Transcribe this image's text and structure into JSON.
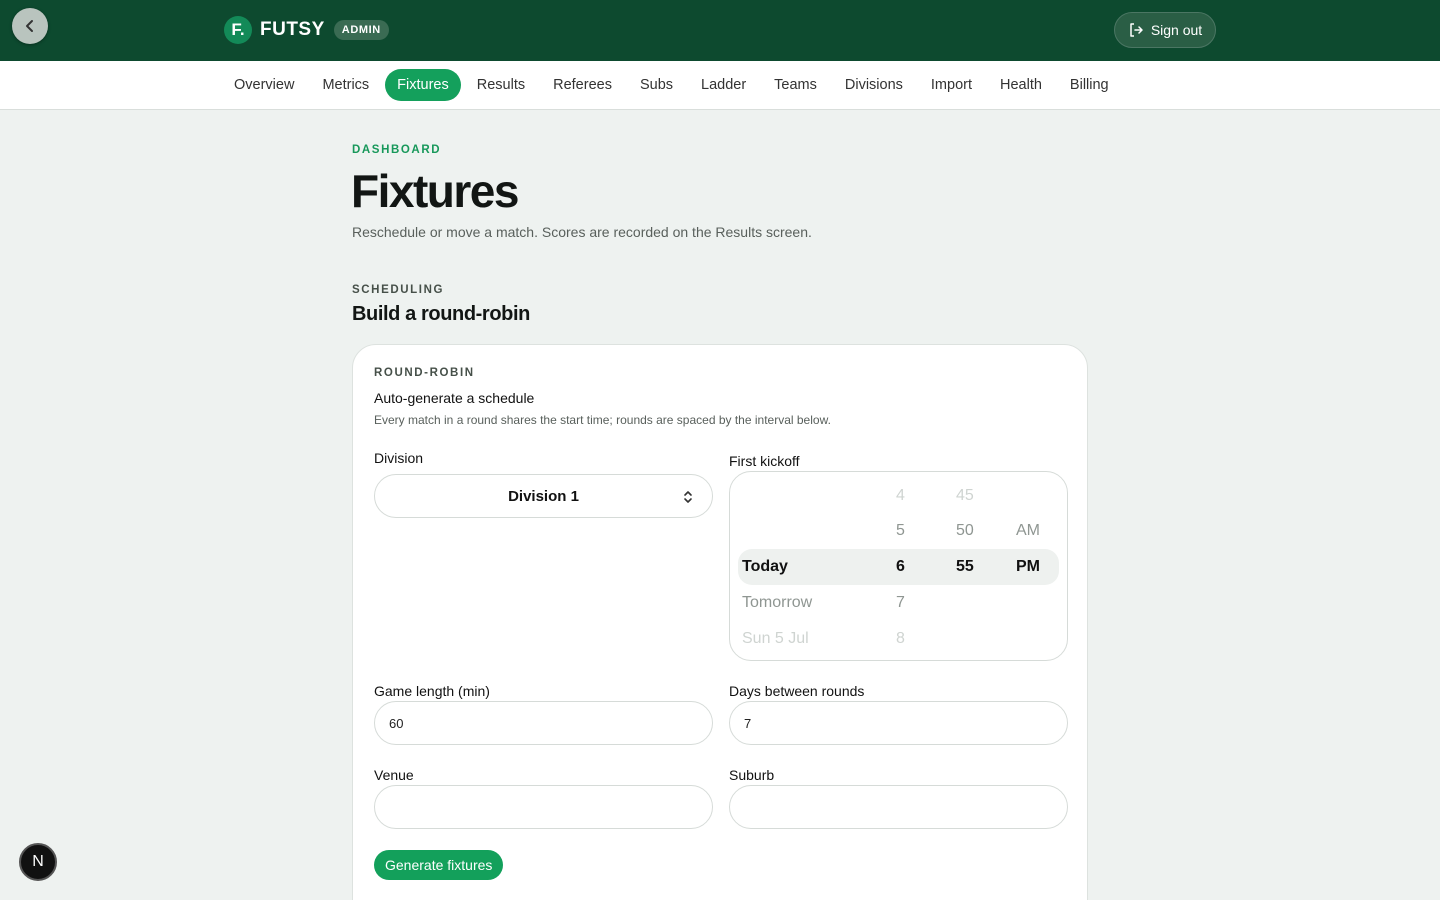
{
  "brand": {
    "logo": "F.",
    "name": "FUTSY",
    "badge": "ADMIN"
  },
  "header": {
    "signout_label": "Sign out"
  },
  "nav": {
    "items": [
      {
        "label": "Overview"
      },
      {
        "label": "Metrics"
      },
      {
        "label": "Fixtures"
      },
      {
        "label": "Results"
      },
      {
        "label": "Referees"
      },
      {
        "label": "Subs"
      },
      {
        "label": "Ladder"
      },
      {
        "label": "Teams"
      },
      {
        "label": "Divisions"
      },
      {
        "label": "Import"
      },
      {
        "label": "Health"
      },
      {
        "label": "Billing"
      }
    ],
    "active": "Fixtures"
  },
  "page": {
    "eyebrow": "DASHBOARD",
    "title": "Fixtures",
    "subtitle": "Reschedule or move a match. Scores are recorded on the Results screen."
  },
  "section": {
    "eyebrow": "SCHEDULING",
    "title": "Build a round-robin"
  },
  "card": {
    "eyebrow": "ROUND-ROBIN",
    "title": "Auto-generate a schedule",
    "description": "Every match in a round shares the start time; rounds are spaced by the interval below.",
    "division": {
      "label": "Division",
      "value": "Division 1"
    },
    "kickoff": {
      "label": "First kickoff",
      "days": [
        "Today",
        "Tomorrow",
        "Sun 5 Jul"
      ],
      "hours": [
        "4",
        "5",
        "6",
        "7",
        "8"
      ],
      "minutes": [
        "45",
        "50",
        "55"
      ],
      "periods": [
        "AM",
        "PM"
      ],
      "selected": {
        "day": "Today",
        "hour": "6",
        "minute": "55",
        "period": "PM"
      }
    },
    "game_length": {
      "label": "Game length (min)",
      "value": "60"
    },
    "days_between": {
      "label": "Days between rounds",
      "value": "7"
    },
    "venue": {
      "label": "Venue",
      "value": ""
    },
    "suburb": {
      "label": "Suburb",
      "value": ""
    },
    "generate_label": "Generate fixtures"
  },
  "dev_badge": {
    "label": "N"
  },
  "icons": {
    "back": "chevron-left-icon",
    "signout": "sign-out-icon",
    "select": "chevron-up-down-icon"
  },
  "colors": {
    "topbar": "#0d4a2f",
    "accent": "#14a05c",
    "background": "#eef2f0"
  }
}
